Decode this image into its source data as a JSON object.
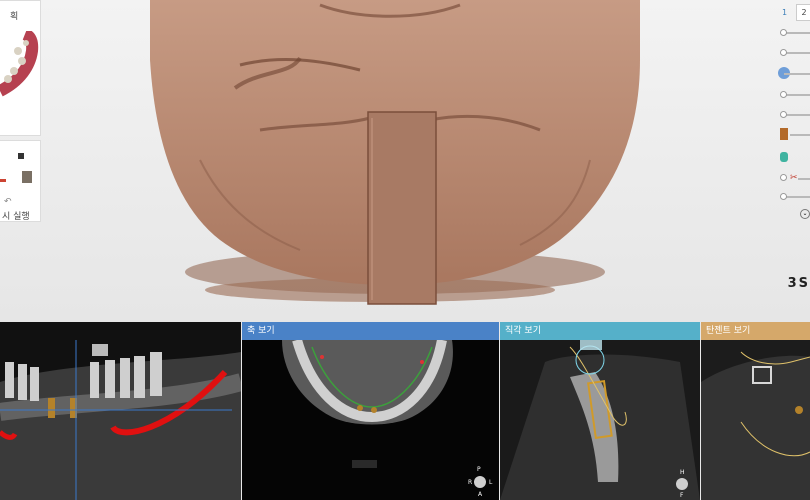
{
  "left_panel": {
    "title_fragment": "획",
    "run_label": "시 실행"
  },
  "toolbar": {
    "page_numbers": [
      "1",
      "2"
    ]
  },
  "brand": "3S",
  "views": {
    "axial_label": "축 보기",
    "orthogonal_label": "직각 보기",
    "tangent_label": "탄젠트 보기"
  },
  "orientation": {
    "axial_top": "P",
    "axial_left": "R",
    "axial_right": "L",
    "axial_bottom": "A",
    "ortho_top": "H",
    "ortho_bottom": "F"
  },
  "colors": {
    "axial_header": "#4a82c7",
    "ortho_header": "#55b0c9",
    "tangent_header": "#d5a86a",
    "bone_render": "#b98b73"
  }
}
